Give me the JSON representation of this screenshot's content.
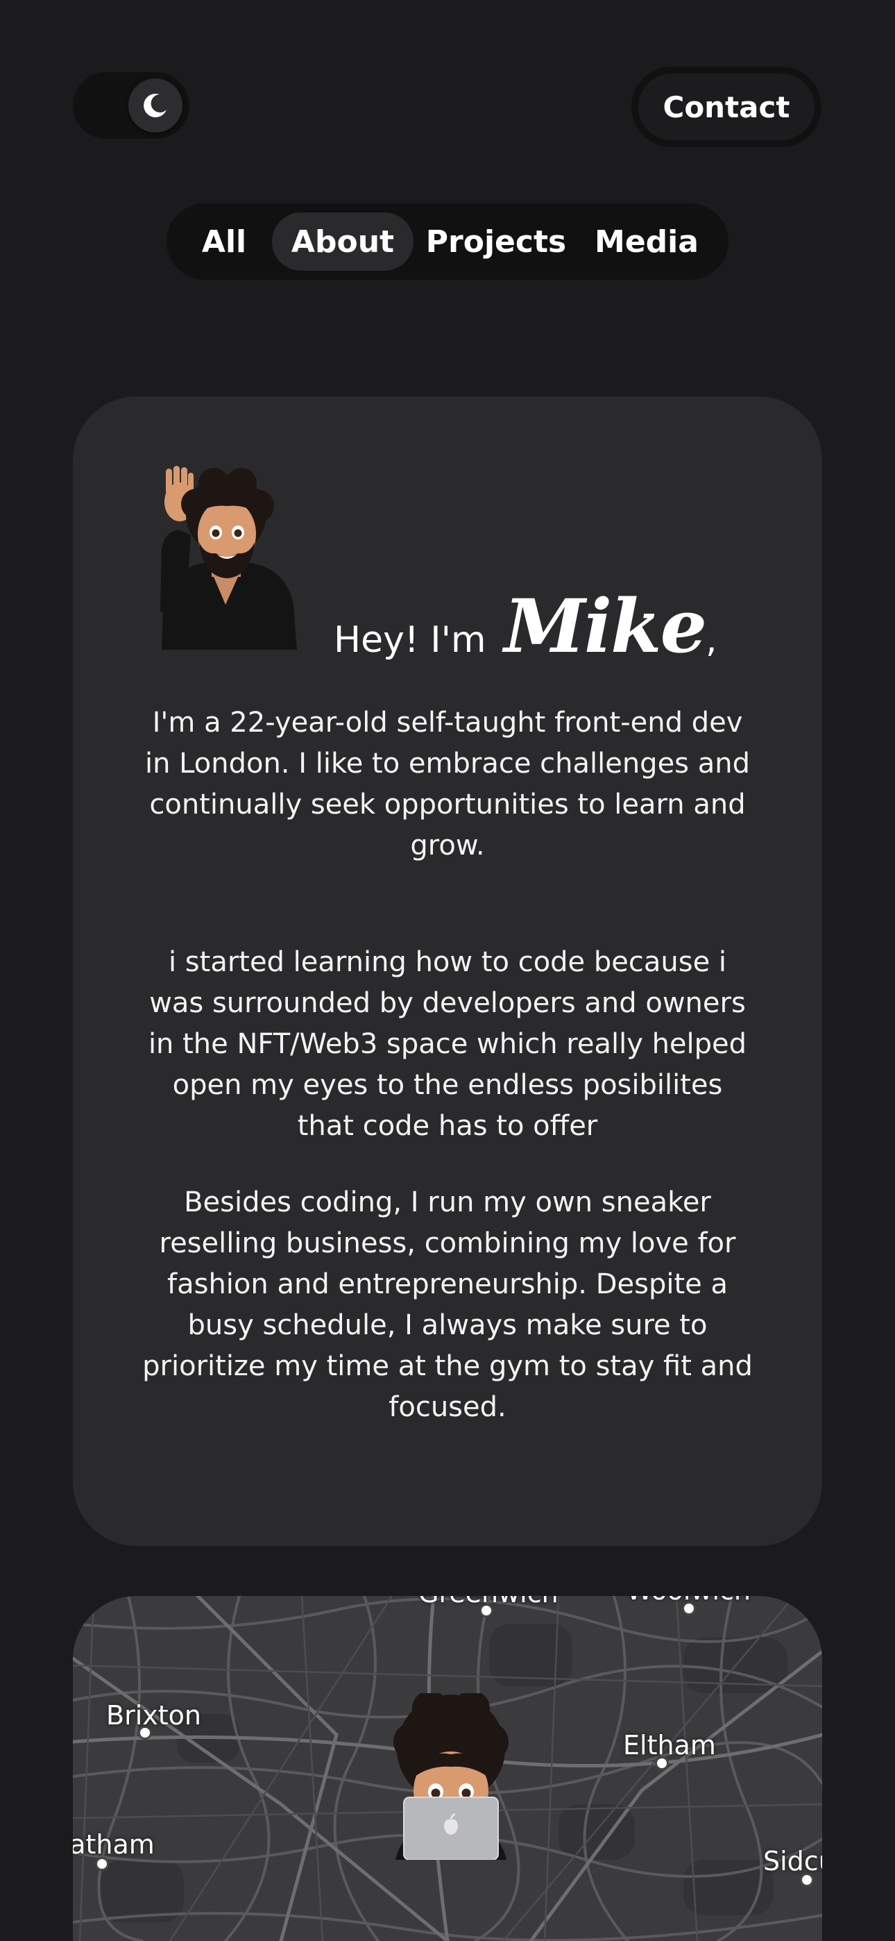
{
  "header": {
    "theme_toggle_icon": "moon-icon",
    "contact_label": "Contact"
  },
  "tabs": [
    {
      "label": "All",
      "active": false
    },
    {
      "label": "About",
      "active": true
    },
    {
      "label": "Projects",
      "active": false
    },
    {
      "label": "Media",
      "active": false
    }
  ],
  "about": {
    "greeting": "Hey! I'm",
    "name": "Mike",
    "comma": ",",
    "paragraphs": [
      "I'm a 22-year-old self-taught front-end dev in London. I like to embrace challenges and continually seek opportunities to learn and grow.",
      "i started learning how to code because i was surrounded by developers and owners in the NFT/Web3 space which really helped open my eyes to the endless posibilites that code has to offer",
      "Besides coding, I run my own sneaker reselling business, combining my love for fashion and entrepreneurship. Despite a busy schedule, I always make sure to prioritize my time at the gym to stay fit and focused."
    ]
  },
  "map": {
    "places": [
      {
        "name": "Greenwich"
      },
      {
        "name": "Woolwich"
      },
      {
        "name": "Brixton"
      },
      {
        "name": "Eltham"
      },
      {
        "name": "Streatham"
      },
      {
        "name": "Sidcup"
      }
    ]
  },
  "colors": {
    "background": "#1b1b1d",
    "card": "#2a2a2c",
    "pill": "#111112",
    "active_tab": "#2a2a2d",
    "text": "#ffffff"
  }
}
